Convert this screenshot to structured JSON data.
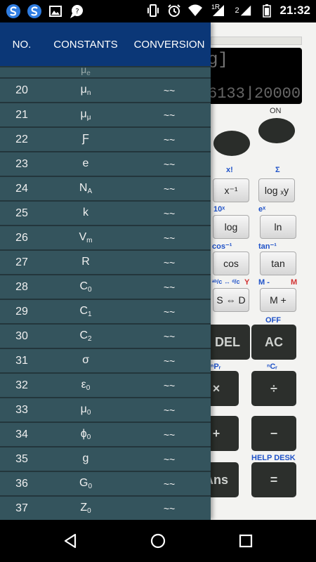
{
  "status_bar": {
    "time": "21:32",
    "signal_label": "R",
    "signal_sub": "1",
    "sim2_label": "2",
    "icons": [
      "app-s-icon",
      "app-s-icon",
      "image-icon",
      "chat-icon",
      "vibrate-icon",
      "alarm-icon",
      "wifi-icon",
      "signal-icon",
      "signal-icon",
      "battery-icon"
    ]
  },
  "calculator": {
    "display_top": "g]",
    "display_bottom": "6133⌋20000",
    "on_label": "ON",
    "labels": {
      "x_fact": "x!",
      "sum": "Σ",
      "ten_x": "10ˣ",
      "e_x": "eˣ",
      "cos_inv": "cos⁻¹",
      "tan_inv": "tan⁻¹",
      "frac": "ᵃᵇ/c ↔ ᵈ/c",
      "y": "Y",
      "m_minus": "M -",
      "m": "M",
      "off": "OFF",
      "npr": "ⁿPᵣ",
      "ncr": "ⁿCᵣ",
      "help_desk": "HELP DESK"
    },
    "keys": {
      "x_inv": "x⁻¹",
      "log_xy": "log ₓy",
      "log": "log",
      "ln": "ln",
      "cos": "cos",
      "tan": "tan",
      "s_d": "S ⇔ D",
      "m_plus": "M +",
      "del": "DEL",
      "ac": "AC",
      "mul": "×",
      "div": "÷",
      "plus": "+",
      "minus": "−",
      "ans": "Ans",
      "eq": "="
    }
  },
  "drawer": {
    "headers": {
      "no": "NO.",
      "constants": "CONSTANTS",
      "conversion": "CONVERSION"
    },
    "partial_row": {
      "no": "",
      "sym": "μ",
      "sub": "e",
      "conv": ""
    },
    "rows": [
      {
        "no": "20",
        "sym": "μ",
        "sub": "n",
        "conv": "~~"
      },
      {
        "no": "21",
        "sym": "μ",
        "sub": "μ",
        "conv": "~~"
      },
      {
        "no": "22",
        "sym": "Ƒ",
        "sub": "",
        "conv": "~~"
      },
      {
        "no": "23",
        "sym": "e",
        "sub": "",
        "conv": "~~"
      },
      {
        "no": "24",
        "sym": "N",
        "sub": "A",
        "conv": "~~"
      },
      {
        "no": "25",
        "sym": "k",
        "sub": "",
        "conv": "~~"
      },
      {
        "no": "26",
        "sym": "V",
        "sub": "m",
        "conv": "~~"
      },
      {
        "no": "27",
        "sym": "R",
        "sub": "",
        "conv": "~~"
      },
      {
        "no": "28",
        "sym": "C",
        "sub": "0",
        "conv": "~~"
      },
      {
        "no": "29",
        "sym": "C",
        "sub": "1",
        "conv": "~~"
      },
      {
        "no": "30",
        "sym": "C",
        "sub": "2",
        "conv": "~~"
      },
      {
        "no": "31",
        "sym": "σ",
        "sub": "",
        "conv": "~~"
      },
      {
        "no": "32",
        "sym": "ε",
        "sub": "0",
        "conv": "~~"
      },
      {
        "no": "33",
        "sym": "μ",
        "sub": "0",
        "conv": "~~"
      },
      {
        "no": "34",
        "sym": "ϕ",
        "sub": "0",
        "conv": "~~"
      },
      {
        "no": "35",
        "sym": "g",
        "sub": "",
        "conv": "~~"
      },
      {
        "no": "36",
        "sym": "G",
        "sub": "0",
        "conv": "~~"
      },
      {
        "no": "37",
        "sym": "Z",
        "sub": "0",
        "conv": "~~"
      }
    ]
  },
  "nav_bar": {
    "icons": [
      "back-icon",
      "home-icon",
      "recents-icon"
    ]
  }
}
